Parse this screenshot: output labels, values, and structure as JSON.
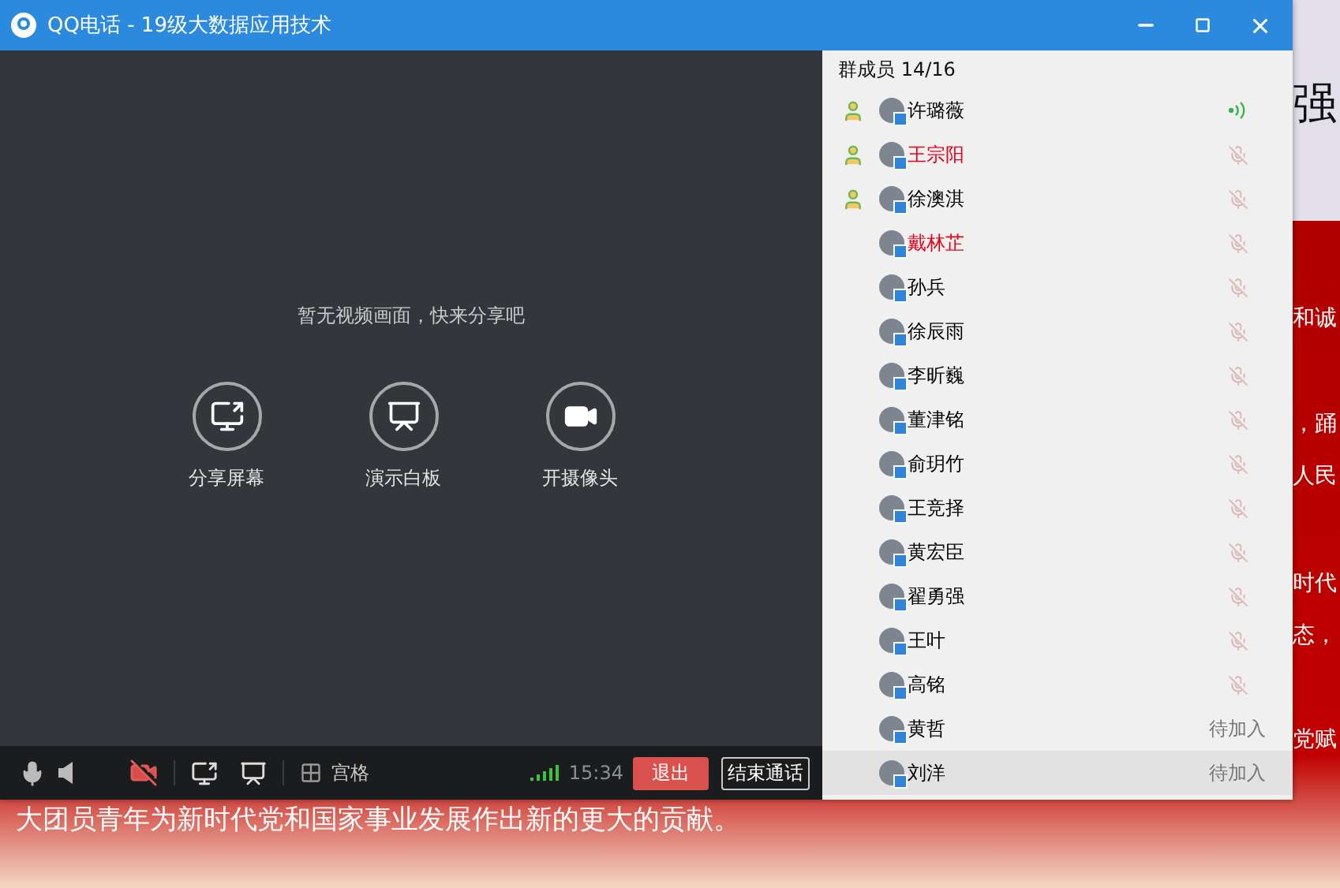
{
  "window": {
    "title": "QQ电话 - 19级大数据应用技术"
  },
  "video": {
    "message": "暂无视频画面，快来分享吧",
    "actions": [
      {
        "label": "分享屏幕",
        "kind": "screen"
      },
      {
        "label": "演示白板",
        "kind": "whiteboard"
      },
      {
        "label": "开摄像头",
        "kind": "camera"
      }
    ]
  },
  "toolbar": {
    "camera_on": false,
    "layout_label": "宫格",
    "time": "15:34",
    "leave_button": "退出",
    "end_button": "结束通话"
  },
  "members": {
    "title": "群成员 14/16",
    "items": [
      {
        "name": "许璐薇",
        "color": "#000000",
        "admin": true,
        "kind": "speaking",
        "selected": false
      },
      {
        "name": "王宗阳",
        "color": "#e5001b",
        "admin": true,
        "kind": "muted",
        "selected": false
      },
      {
        "name": "徐澳淇",
        "color": "#000000",
        "admin": true,
        "kind": "muted",
        "selected": false
      },
      {
        "name": "戴林芷",
        "color": "#e5001b",
        "admin": false,
        "kind": "muted",
        "selected": false
      },
      {
        "name": "孙兵",
        "color": "#000000",
        "admin": false,
        "kind": "muted",
        "selected": false
      },
      {
        "name": "徐辰雨",
        "color": "#000000",
        "admin": false,
        "kind": "muted",
        "selected": false
      },
      {
        "name": "李昕巍",
        "color": "#000000",
        "admin": false,
        "kind": "muted",
        "selected": false
      },
      {
        "name": "董津铭",
        "color": "#000000",
        "admin": false,
        "kind": "muted",
        "selected": false
      },
      {
        "name": "俞玥竹",
        "color": "#000000",
        "admin": false,
        "kind": "muted",
        "selected": false
      },
      {
        "name": "王竞择",
        "color": "#000000",
        "admin": false,
        "kind": "muted",
        "selected": false
      },
      {
        "name": "黄宏臣",
        "color": "#000000",
        "admin": false,
        "kind": "muted",
        "selected": false
      },
      {
        "name": "翟勇强",
        "color": "#000000",
        "admin": false,
        "kind": "muted",
        "selected": false
      },
      {
        "name": "王叶",
        "color": "#000000",
        "admin": false,
        "kind": "muted",
        "selected": false
      },
      {
        "name": "高铭",
        "color": "#000000",
        "admin": false,
        "kind": "muted",
        "selected": false
      },
      {
        "name": "黄哲",
        "color": "#000000",
        "admin": false,
        "kind": "pending",
        "status_text": "待加入",
        "selected": false
      },
      {
        "name": "刘洋",
        "color": "#000000",
        "admin": false,
        "kind": "pending",
        "status_text": "待加入",
        "selected": true
      }
    ]
  },
  "background": {
    "heading_fragment": "强",
    "fragments": [
      "和诚",
      "，踊",
      "人民",
      "时代",
      "态，",
      "党赋"
    ],
    "bottom_line": "大团员青年为新时代党和国家事业发展作出新的更大的贡献。"
  }
}
